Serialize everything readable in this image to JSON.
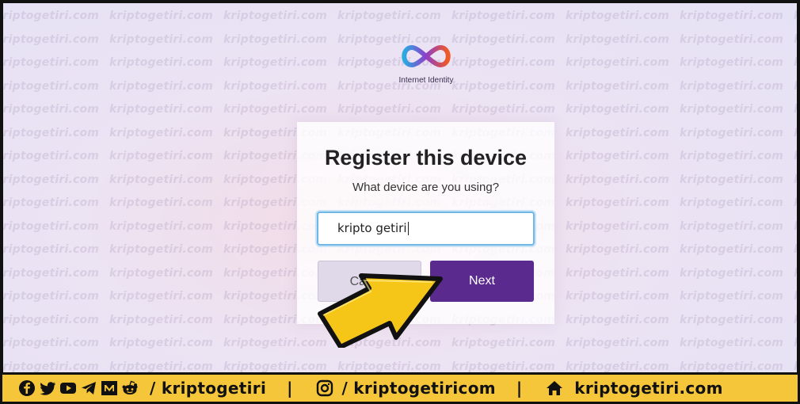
{
  "watermark": {
    "text": "kriptogetiri.com"
  },
  "logo": {
    "caption": "Internet Identity"
  },
  "card": {
    "title": "Register this device",
    "subtitle": "What device are you using?",
    "device_input": {
      "value": "kripto getiri"
    },
    "cancel_label": "Cancel",
    "next_label": "Next"
  },
  "footer": {
    "social_handle": "/ kriptogetiri",
    "separator": "|",
    "instagram_handle": "/ kriptogetiricom",
    "website": "kriptogetiri.com",
    "icons": [
      "facebook-icon",
      "twitter-icon",
      "youtube-icon",
      "telegram-icon",
      "medium-icon",
      "reddit-icon",
      "instagram-icon",
      "home-icon"
    ]
  },
  "colors": {
    "accent": "#5b2a8e",
    "footer_bg": "#f6c63a",
    "arrow": "#f5c518"
  }
}
